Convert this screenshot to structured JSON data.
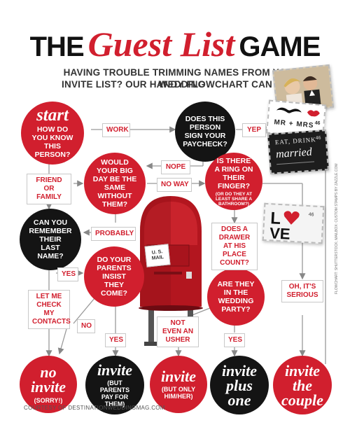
{
  "title": {
    "part1": "THE",
    "part2": "Guest List",
    "part3": "GAME"
  },
  "subtitle": {
    "line1": "HAVING TROUBLE TRIMMING NAMES FROM YOUR WEDDING",
    "line2": "INVITE LIST? OUR HANDY FLOWCHART CAN HELP."
  },
  "nodes": {
    "start": {
      "head": "start",
      "body": "HOW DO YOU KNOW THIS PERSON?"
    },
    "paycheck": "DOES THIS PERSON SIGN YOUR PAYCHECK?",
    "bigday": "WOULD YOUR BIG DAY BE THE SAME WITHOUT THEM?",
    "ring": {
      "body": "IS THERE A RING ON THEIR FINGER?",
      "note": "(OR DO THEY AT LEAST SHARE A BATHROOM?)"
    },
    "lastname": "CAN YOU REMEMBER THEIR LAST NAME?",
    "parents": "DO YOUR PARENTS INSIST THEY COME?",
    "party": "ARE THEY IN THE WEDDING PARTY?",
    "no_invite": {
      "head": "no invite",
      "body": "(SORRY!)"
    },
    "invite_parents": {
      "head": "invite",
      "body": "(BUT PARENTS PAY FOR THEM)"
    },
    "invite_only": {
      "head": "invite",
      "body": "(BUT ONLY HIM/HER)"
    },
    "invite_plus": {
      "head": "invite plus one"
    },
    "invite_couple": {
      "head": "invite the couple"
    }
  },
  "labels": {
    "work": "WORK",
    "yep": "YEP",
    "nope": "NOPE",
    "friend": "FRIEND OR FAMILY",
    "noway": "NO WAY",
    "probably": "PROBABLY",
    "yes1": "YES",
    "letme": "LET ME CHECK MY CONTACTS",
    "no": "NO",
    "yes2": "YES",
    "usher": "NOT EVEN AN USHER",
    "yes3": "YES",
    "drawer": "DOES A DRAWER AT HIS PLACE COUNT?",
    "serious": "OH, IT'S SERIOUS"
  },
  "mailbox": {
    "sign": "U. S. MAIL"
  },
  "stamps": {
    "mrmrs": "MR + MRS",
    "eatdrink": "EAT, DRINK",
    "married": "married",
    "love1": "L",
    "love2": "VE",
    "value": "46",
    "zazzle": "ZAZZLE.COM"
  },
  "footer": "COURTESY OF DESTINATIONWEDDINGMAG.COM",
  "credit": "FLOWCHART: SHUTTERSTOCK; MAILBOX: CUSTOM STAMPS BY ZAZZLE.COM",
  "colors": {
    "red": "#d11f2e",
    "black": "#141414"
  }
}
